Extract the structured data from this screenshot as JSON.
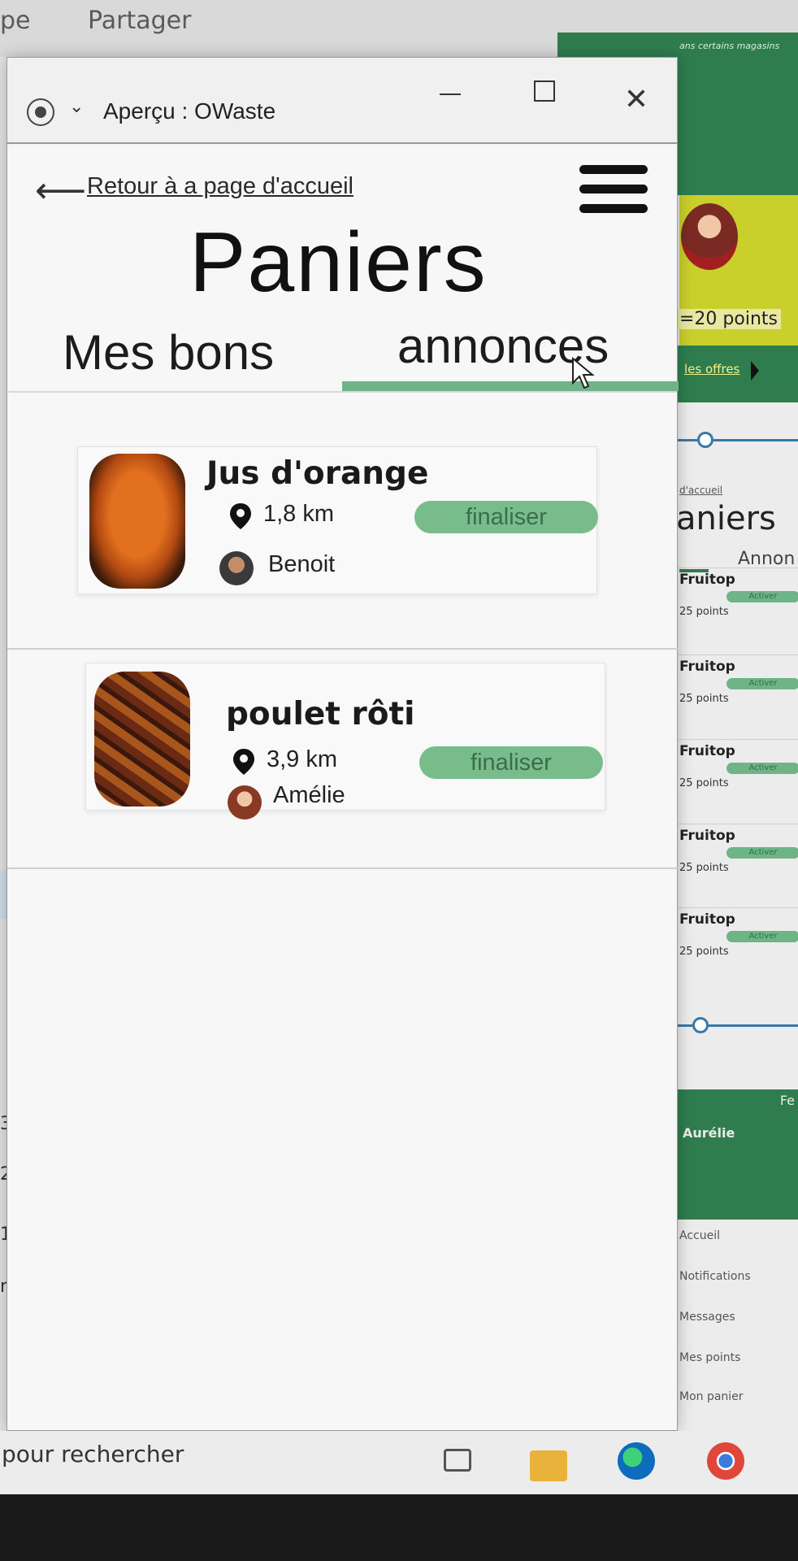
{
  "background": {
    "top_left_fragment": "pe",
    "top_share": "Partager",
    "left_numbers": [
      "3",
      "2",
      "1",
      "n"
    ]
  },
  "right_preview": {
    "header_text": "ans certains magasins",
    "points": "=20 points",
    "offers_link": "les offres",
    "back_link": "d'accueil",
    "title": "aniers",
    "tab": "Annon",
    "items": [
      {
        "name": "Fruitop",
        "points": "25 points",
        "action": "Activer"
      },
      {
        "name": "Fruitop",
        "points": "25 points",
        "action": "Activer"
      },
      {
        "name": "Fruitop",
        "points": "25 points",
        "action": "Activer"
      },
      {
        "name": "Fruitop",
        "points": "25 points",
        "action": "Activer"
      },
      {
        "name": "Fruitop",
        "points": "25 points",
        "action": "Activer"
      }
    ],
    "footer_top": "Fe",
    "footer_user": "Aurélie",
    "menu": [
      "Accueil",
      "Notifications",
      "Messages",
      "Mes points",
      "Mon panier"
    ]
  },
  "window": {
    "title": "Aperçu : OWaste",
    "minimize_icon": "minimize-icon",
    "maximize_icon": "maximize-icon",
    "close_icon": "close-icon"
  },
  "page": {
    "back_label": "Retour à a page d'accueil",
    "title": "Paniers",
    "tabs": [
      {
        "label": "Mes bons",
        "active": false
      },
      {
        "label": "annonces",
        "active": true
      }
    ],
    "accent": "#79bc8c"
  },
  "listings": [
    {
      "name": "Jus d'orange",
      "distance": "1,8 km",
      "user": "Benoit",
      "action": "finaliser"
    },
    {
      "name": "poulet rôti",
      "distance": "3,9 km",
      "user": "Amélie",
      "action": "finaliser"
    }
  ],
  "taskbar": {
    "search_placeholder": "pour rechercher",
    "icons": [
      "task-view-icon",
      "folder-icon",
      "edge-icon",
      "chrome-icon"
    ]
  }
}
